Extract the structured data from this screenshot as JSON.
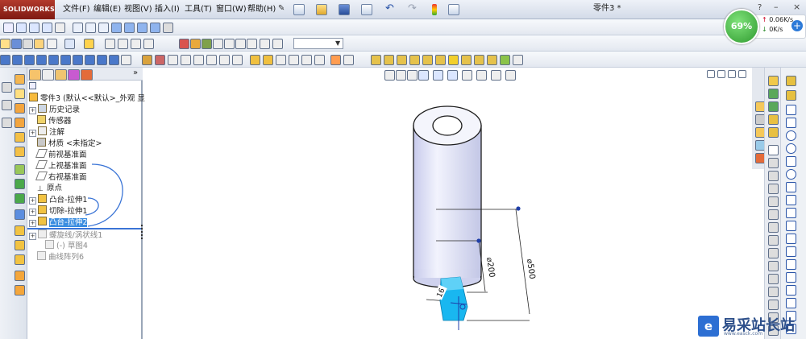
{
  "app": {
    "logo_text": "SOLIDWORKS",
    "document_title": "零件3 *"
  },
  "menu": [
    "文件(F)",
    "编辑(E)",
    "视图(V)",
    "插入(I)",
    "工具(T)",
    "窗口(W)",
    "帮助(H)"
  ],
  "network": {
    "percent": "69%",
    "upload": "0.06K/s",
    "download": "0K/s"
  },
  "feature_tree": {
    "root": "零件3 (默认<<默认>_外观 显",
    "items": [
      {
        "label": "历史记录",
        "state": "normal"
      },
      {
        "label": "传感器",
        "state": "normal"
      },
      {
        "label": "注解",
        "state": "normal"
      },
      {
        "label": "材质 <未指定>",
        "state": "normal"
      },
      {
        "label": "前视基准面",
        "state": "normal"
      },
      {
        "label": "上视基准面",
        "state": "normal"
      },
      {
        "label": "右视基准面",
        "state": "normal"
      },
      {
        "label": "原点",
        "state": "normal"
      },
      {
        "label": "凸台-拉伸1",
        "state": "normal"
      },
      {
        "label": "切除-拉伸1",
        "state": "normal"
      },
      {
        "label": "凸台-拉伸2",
        "state": "selected"
      },
      {
        "label": "螺旋线/涡状线1",
        "state": "grey"
      },
      {
        "label": "(-) 草图4",
        "state": "grey"
      },
      {
        "label": "曲线阵列6",
        "state": "grey"
      }
    ]
  },
  "dimensions": {
    "d1": "⌀200",
    "d2": "⌀500",
    "d3": "16"
  },
  "watermark": {
    "text": "易采站长站",
    "sub": "www.easck.com"
  },
  "colors": {
    "cylinder": "#dfe1f6",
    "selection": "#3b8de0",
    "annotation": "#3a74d6",
    "highlight_block": "#19b7f0"
  }
}
